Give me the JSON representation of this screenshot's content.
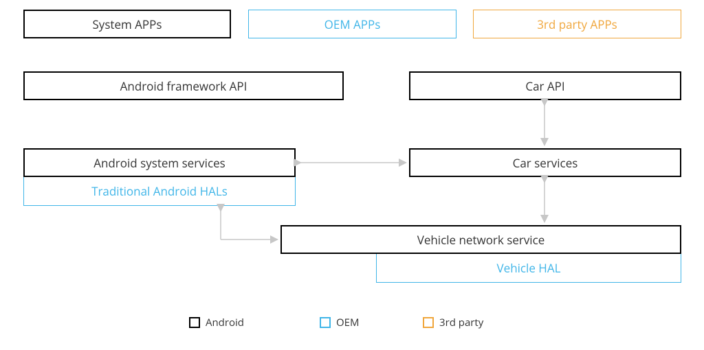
{
  "boxes": {
    "system_apps": "System APPs",
    "oem_apps": "OEM APPs",
    "third_party_apps": "3rd party APPs",
    "android_fw_api": "Android framework API",
    "car_api": "Car API",
    "android_services": "Android system services",
    "car_services": "Car services",
    "trad_hals": "Traditional Android HALs",
    "vns": "Vehicle network service",
    "vehicle_hal": "Vehicle HAL"
  },
  "legend": {
    "android": "Android",
    "oem": "OEM",
    "third": "3rd party"
  },
  "colors": {
    "android": "#000000",
    "oem": "#3FB5E8",
    "third": "#F0A63B",
    "arrow": "#C7C7C7"
  }
}
